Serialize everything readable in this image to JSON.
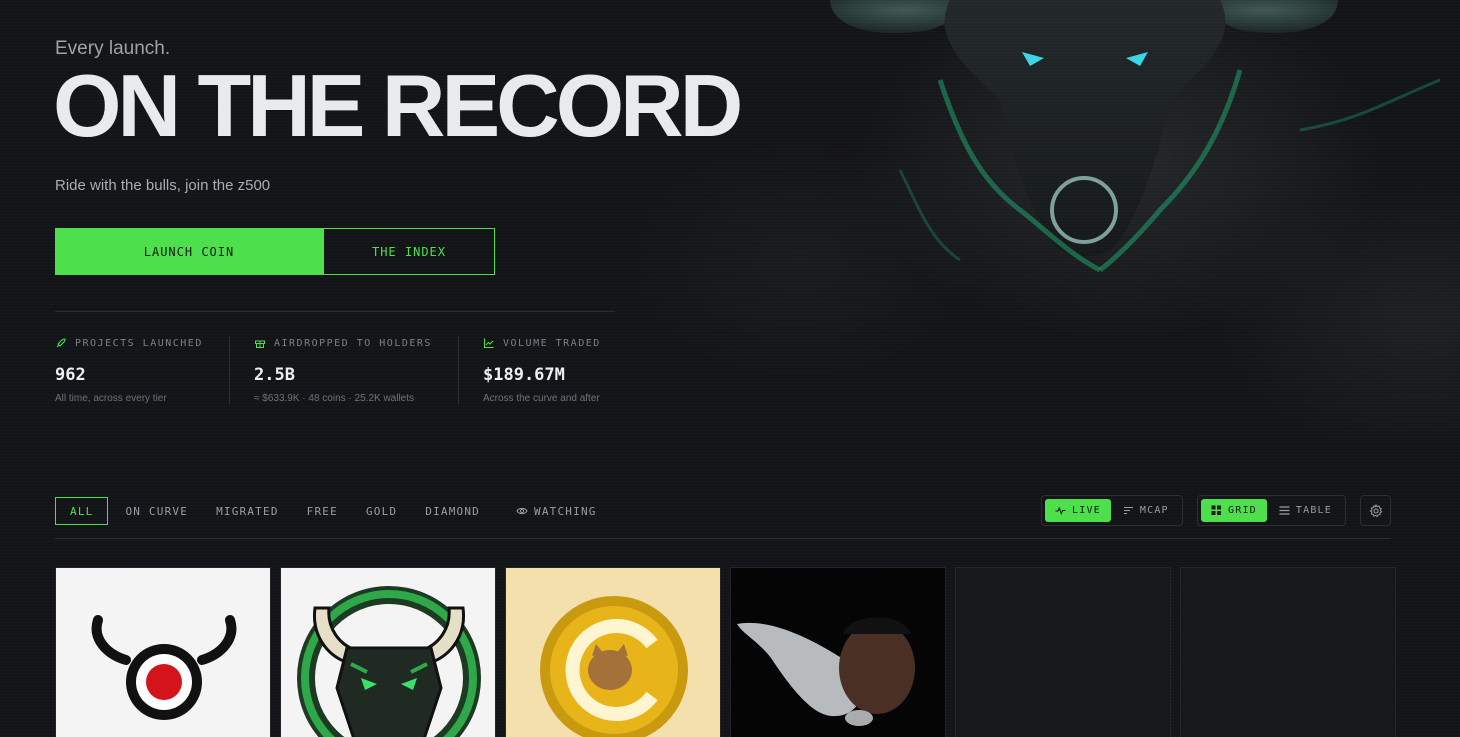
{
  "hero": {
    "eyebrow": "Every launch.",
    "headline": "ON THE RECORD",
    "subline": "Ride with the bulls, join the z500",
    "primary_cta": "LAUNCH COIN",
    "secondary_cta": "THE INDEX"
  },
  "stats": [
    {
      "icon": "rocket-icon",
      "label": "PROJECTS LAUNCHED",
      "value": "962",
      "sub": "All time, across every tier"
    },
    {
      "icon": "gift-icon",
      "label": "AIRDROPPED TO HOLDERS",
      "value": "2.5B",
      "sub": "≈ $633.9K · 48 coins · 25.2K wallets"
    },
    {
      "icon": "chart-icon",
      "label": "VOLUME TRADED",
      "value": "$189.67M",
      "sub": "Across the curve and after"
    }
  ],
  "filters": {
    "items": [
      "ALL",
      "ON CURVE",
      "MIGRATED",
      "FREE",
      "GOLD",
      "DIAMOND"
    ],
    "watching": "WATCHING",
    "active": "ALL"
  },
  "sort_toggle": {
    "live": "LIVE",
    "mcap": "MCAP",
    "active": "LIVE"
  },
  "view_toggle": {
    "grid": "GRID",
    "table": "TABLE",
    "active": "GRID"
  },
  "colors": {
    "accent": "#4ee04c",
    "background": "#131417",
    "bull_eye": "#39d6e6",
    "bull_glow": "#1fa36b"
  },
  "cards": [
    {
      "image": "bull-target-logo"
    },
    {
      "image": "pixel-bull-logo"
    },
    {
      "image": "gold-cat-coin"
    },
    {
      "image": "fish-man-meme"
    },
    {
      "image": "empty"
    },
    {
      "image": "empty"
    }
  ]
}
